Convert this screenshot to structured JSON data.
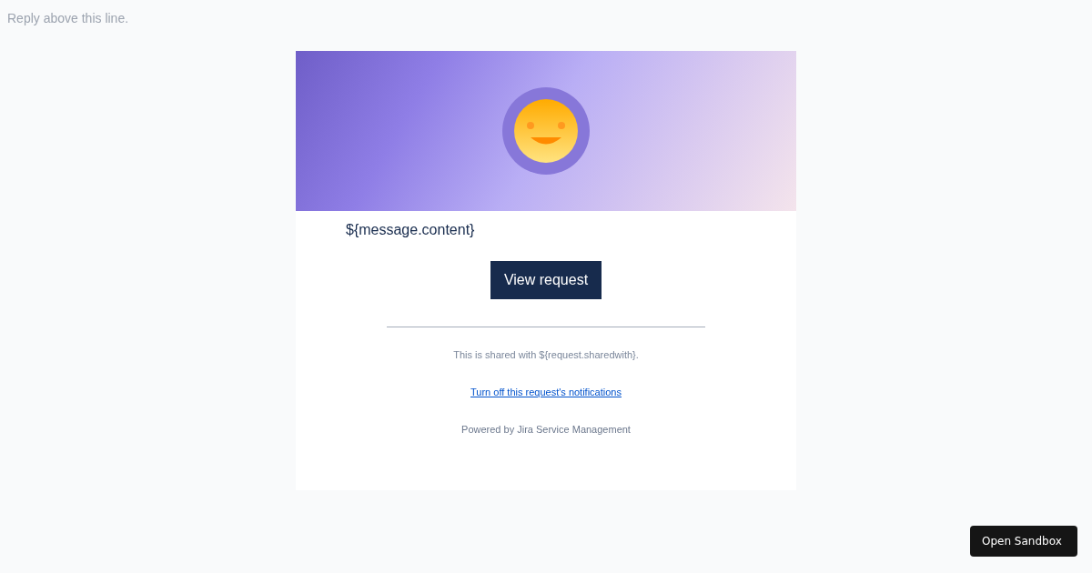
{
  "reply_line": "Reply above this line.",
  "email": {
    "message": "${message.content}",
    "button": "View request",
    "shared_note": "This is shared with ${request.sharedwith}.",
    "unsubscribe_link": "Turn off this request's notifications",
    "powered_by": "Powered by Jira Service Management"
  },
  "sandbox_button": "Open Sandbox"
}
